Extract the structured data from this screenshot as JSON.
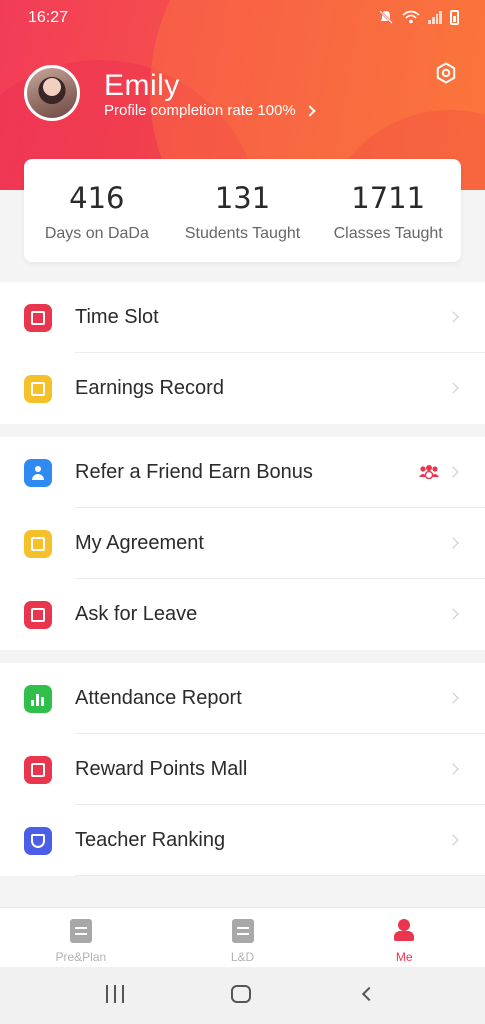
{
  "status_bar": {
    "time": "16:27"
  },
  "profile": {
    "name": "Emily",
    "completion_text": "Profile completion rate 100%"
  },
  "stats": [
    {
      "value": "416",
      "label": "Days on DaDa"
    },
    {
      "value": "131",
      "label": "Students Taught"
    },
    {
      "value": "1711",
      "label": "Classes Taught"
    }
  ],
  "menu_groups": [
    {
      "items": [
        {
          "label": "Time Slot",
          "icon": "calendar-icon",
          "color": "#e9364e"
        },
        {
          "label": "Earnings Record",
          "icon": "wallet-icon",
          "color": "#f6c02b"
        }
      ]
    },
    {
      "items": [
        {
          "label": "Refer a Friend Earn Bonus",
          "icon": "refer-friend-icon",
          "color": "#2f8bf2",
          "badge_icon": "bonus-people-icon"
        },
        {
          "label": "My Agreement",
          "icon": "document-icon",
          "color": "#f6c02b"
        },
        {
          "label": "Ask for Leave",
          "icon": "leave-request-icon",
          "color": "#e9364e"
        }
      ]
    },
    {
      "items": [
        {
          "label": "Attendance Report",
          "icon": "bar-chart-icon",
          "color": "#2fbf4a"
        },
        {
          "label": "Reward Points Mall",
          "icon": "shopping-bag-icon",
          "color": "#e9364e"
        },
        {
          "label": "Teacher Ranking",
          "icon": "trophy-icon",
          "color": "#4b5ee8"
        }
      ]
    }
  ],
  "bottom_nav": [
    {
      "label": "Pre&Plan",
      "icon": "clipboard-icon",
      "active": false
    },
    {
      "label": "L&D",
      "icon": "learning-icon",
      "active": false
    },
    {
      "label": "Me",
      "icon": "profile-icon",
      "active": true
    }
  ],
  "colors": {
    "accent": "#e9364e",
    "header_start": "#f23c57",
    "header_end": "#f7703a"
  }
}
